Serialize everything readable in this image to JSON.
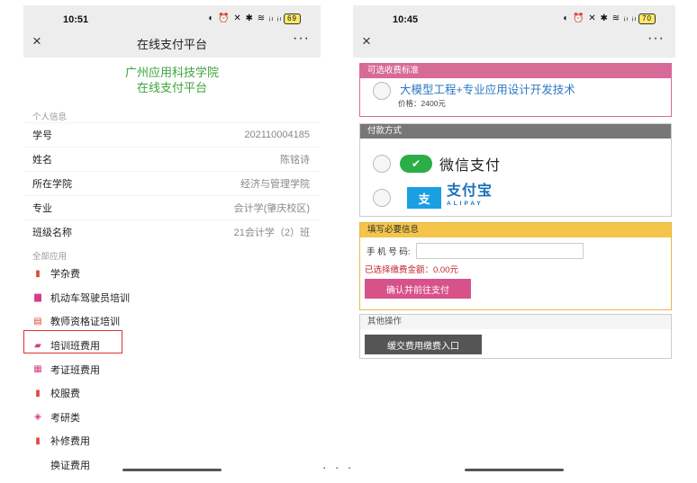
{
  "left": {
    "status": {
      "time": "10:51",
      "icons": "◐ ⏰ ✕ ✱ ≋ ᵢₗ ᵢₗ",
      "battery": "69"
    },
    "nav": {
      "close": "×",
      "title": "在线支付平台",
      "more": "···"
    },
    "school_name": "广州应用科技学院",
    "school_sub": "在线支付平台",
    "personal_label": "个人信息",
    "info_rows": [
      {
        "label": "学号",
        "value": "202110004185"
      },
      {
        "label": "姓名",
        "value": "陈铭诗"
      },
      {
        "label": "所在学院",
        "value": "经济与管理学院"
      },
      {
        "label": "专业",
        "value": "会计学(肇庆校区)"
      },
      {
        "label": "班级名称",
        "value": "21会计学（2）班"
      }
    ],
    "apps_label": "全部应用",
    "apps": [
      {
        "label": "学杂费",
        "icon": "bar-chart-icon",
        "color": "#e04a3a"
      },
      {
        "label": "机动车驾驶员培训",
        "icon": "bus-icon",
        "color": "#d83b8f"
      },
      {
        "label": "教师资格证培训",
        "icon": "doc-icon",
        "color": "#e04a3a"
      },
      {
        "label": "培训班费用",
        "icon": "briefcase-icon",
        "color": "#d83b8f"
      },
      {
        "label": "考证班费用",
        "icon": "certificate-icon",
        "color": "#d83b8f"
      },
      {
        "label": "校服费",
        "icon": "bar-chart-icon",
        "color": "#e04a3a"
      },
      {
        "label": "考研类",
        "icon": "graduation-cap-icon",
        "color": "#d83b8f"
      },
      {
        "label": "补修费用",
        "icon": "bar-chart-icon",
        "color": "#e04a3a"
      },
      {
        "label": "换证费用",
        "icon": "",
        "color": "#e04a3a"
      }
    ]
  },
  "right": {
    "status": {
      "time": "10:45",
      "icons": "◐ ⏰ ✕ ✱ ≋ ᵢₗ ᵢₗ",
      "battery": "70"
    },
    "nav": {
      "close": "×",
      "more": "···"
    },
    "fee_header": "可选收费标准",
    "fee_name": "大模型工程+专业应用设计开发技术",
    "fee_price": "价格：2400元",
    "pay_header": "付款方式",
    "wechat_label": "微信支付",
    "alipay_label": "支付宝",
    "alipay_sub": "ALIPAY",
    "info_header": "填写必要信息",
    "phone_label": "手 机 号 码:",
    "phone_value": "",
    "amount_text": "已选择缴费金额：0.00元",
    "confirm_btn": "确认并前往支付",
    "other_header": "其他操作",
    "supp_btn": "缓交费用缴费入口"
  },
  "separator": "· · ·"
}
